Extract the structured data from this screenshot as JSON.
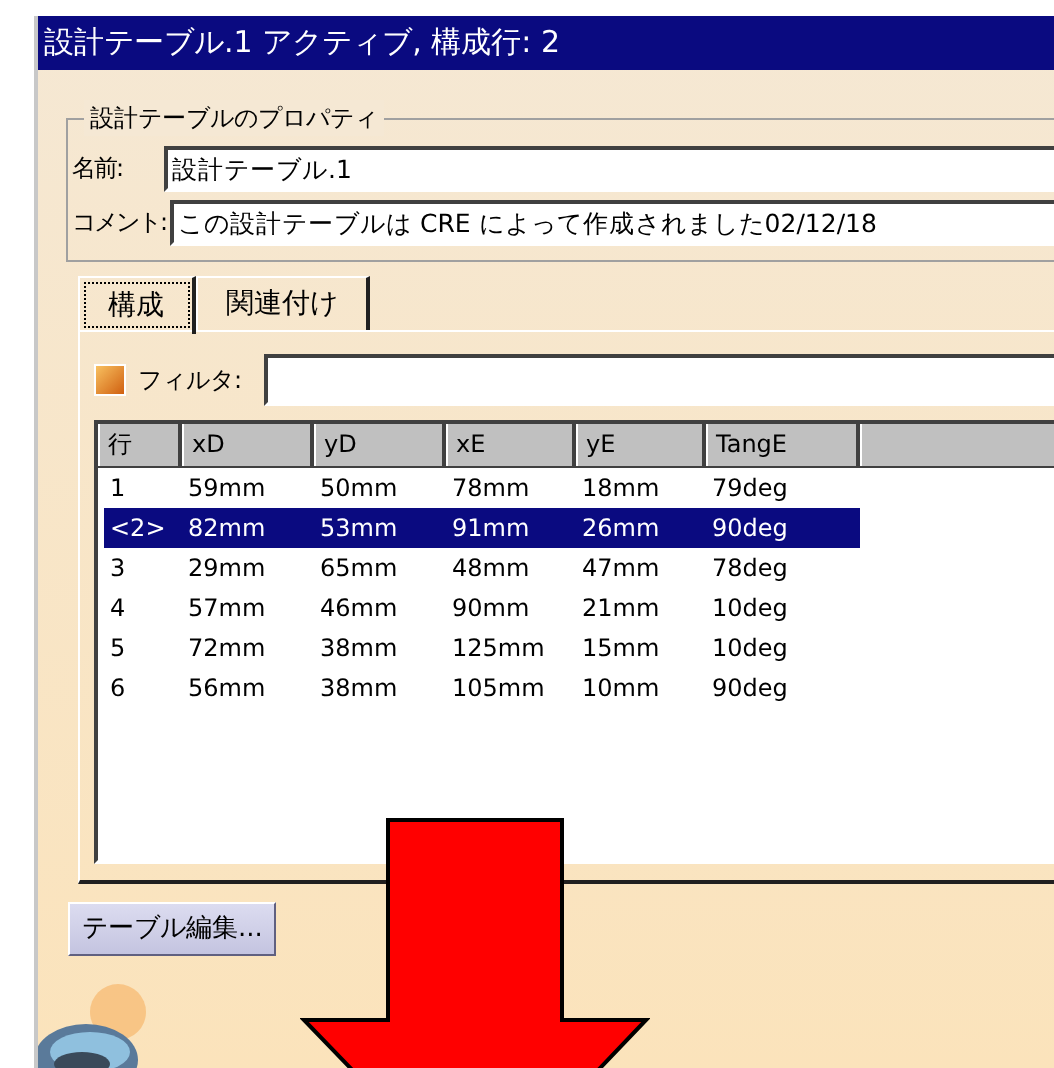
{
  "window": {
    "title": "設計テーブル.1 アクティブ, 構成行: 2"
  },
  "properties": {
    "legend": "設計テーブルのプロパティ",
    "name_label": "名前:",
    "name_value": "設計テーブル.1",
    "comment_label": "コメント:",
    "comment_value": "この設計テーブルは CRE によって作成されました02/12/18"
  },
  "tabs": [
    {
      "label": "構成",
      "selected": true
    },
    {
      "label": "関連付け",
      "selected": false
    }
  ],
  "filter": {
    "label": "フィルタ:",
    "checked": false
  },
  "table": {
    "columns": [
      "行",
      "xD",
      "yD",
      "xE",
      "yE",
      "TangE"
    ],
    "rows": [
      {
        "cells": [
          "1",
          "59mm",
          "50mm",
          "78mm",
          "18mm",
          "79deg"
        ],
        "selected": false
      },
      {
        "cells": [
          "<2>",
          "82mm",
          "53mm",
          "91mm",
          "26mm",
          "90deg"
        ],
        "selected": true
      },
      {
        "cells": [
          "3",
          "29mm",
          "65mm",
          "48mm",
          "47mm",
          "78deg"
        ],
        "selected": false
      },
      {
        "cells": [
          "4",
          "57mm",
          "46mm",
          "90mm",
          "21mm",
          "10deg"
        ],
        "selected": false
      },
      {
        "cells": [
          "5",
          "72mm",
          "38mm",
          "125mm",
          "15mm",
          "10deg"
        ],
        "selected": false
      },
      {
        "cells": [
          "6",
          "56mm",
          "38mm",
          "105mm",
          "10mm",
          "90deg"
        ],
        "selected": false
      }
    ]
  },
  "buttons": [
    "テーブル編集..."
  ]
}
